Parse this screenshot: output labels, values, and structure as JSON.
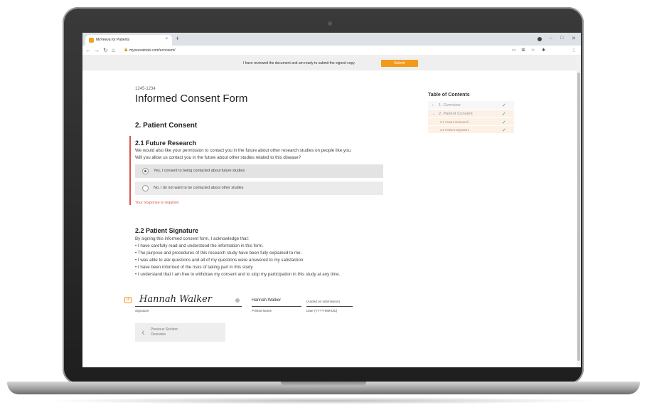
{
  "browser": {
    "tab_title": "MyVeeva for Patients",
    "tab_close": "×",
    "new_tab": "+",
    "url": "myveevatrials.com/econsent/",
    "window_controls": [
      "–",
      "□",
      "✕"
    ]
  },
  "notice": {
    "text": "I have reviewed the document and am ready to submit the signed copy.",
    "submit_label": "Submit"
  },
  "document": {
    "study_id": "1245-1234",
    "title": "Informed Consent Form",
    "section_title": "2. Patient Consent",
    "future": {
      "title": "2.1 Future Research",
      "line1": "We would also like your permission to contact you in the future about other research studies on people like you.",
      "line2": "Will you allow us contact you in the future about other studies related to this disease?",
      "option_yes": "Yes, I consent to being contacted about future studies",
      "option_no": "No, I do not want to be contacted about other studies",
      "error": "Your response is required"
    },
    "signature": {
      "title": "2.2 Patient Signature",
      "intro": "By signing this informed consent form, I acknowledge that:",
      "bullets": [
        "• I have carefully read and understood the information in this form.",
        "• The purpose and procedures of this research study have been fully explained to me.",
        "• I was able to ask questions and all of my questions were answered to my satisfaction.",
        "• I have been informed of the risks of taking part in this study",
        "• I understand that I am free to withdraw my consent and to stop my participation in this study at any time."
      ],
      "handwritten": "Hannah Walker",
      "signature_label": "Signature",
      "printed_name": "Hannah Walker",
      "printed_name_label": "Printed Name",
      "date_value": "(Added on submission)",
      "date_label": "Date (YYYY-MM-DD)"
    },
    "prev": {
      "line1": "Previous Section:",
      "line2": "Overview"
    }
  },
  "toc": {
    "title": "Table of Contents",
    "items": [
      {
        "label": "1. Overview",
        "chevron": "›",
        "check": "✓"
      },
      {
        "label": "2. Patient Consent",
        "chevron": "⌄",
        "check": "✓"
      },
      {
        "label": "2.1 Future Research",
        "check": "✓"
      },
      {
        "label": "2.2 Patient Signature",
        "check": "✓"
      }
    ]
  },
  "colors": {
    "accent": "#f39a1b",
    "error": "#d9534f",
    "check": "#43a047"
  }
}
